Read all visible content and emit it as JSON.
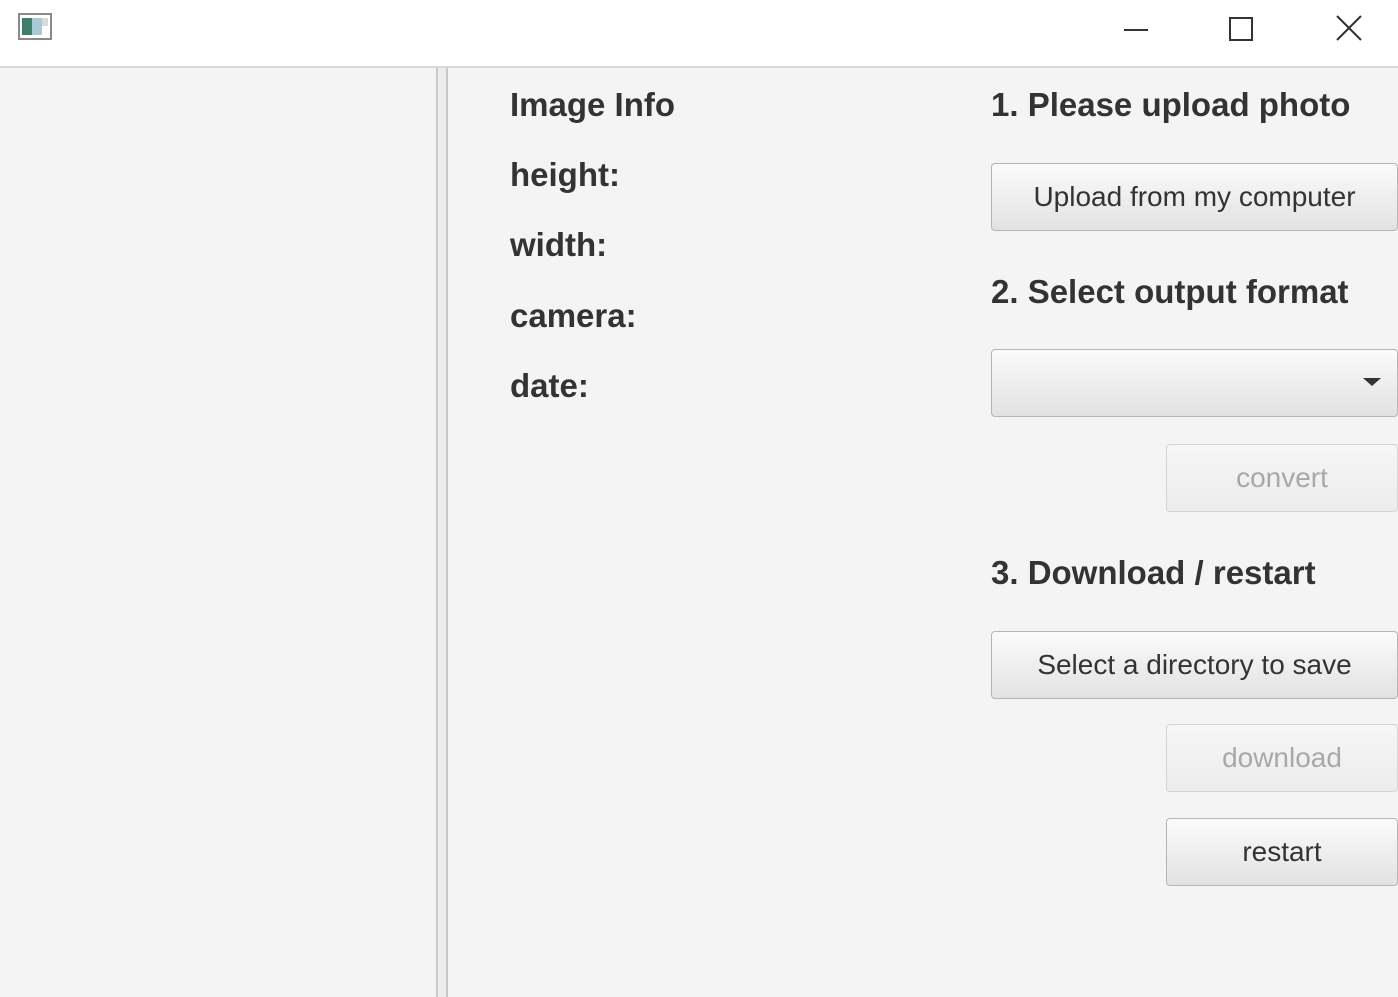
{
  "window": {
    "controls": {
      "minimize_icon": "minimize-icon",
      "maximize_icon": "maximize-icon",
      "close_icon": "close-icon"
    }
  },
  "image_info": {
    "heading": "Image Info",
    "height_label": "height:",
    "width_label": "width:",
    "camera_label": "camera:",
    "date_label": "date:"
  },
  "steps": {
    "upload": {
      "title": "1. Please upload photo",
      "button": "Upload from my computer"
    },
    "format": {
      "title": "2. Select output format",
      "selected": "",
      "convert_button": "convert",
      "convert_enabled": false
    },
    "download": {
      "title": "3. Download / restart",
      "directory_button": "Select a directory to save",
      "download_button": "download",
      "download_enabled": false,
      "restart_button": "restart"
    }
  },
  "colors": {
    "background": "#f4f4f4",
    "text": "#333333",
    "disabled_text": "#a8a8a8"
  }
}
